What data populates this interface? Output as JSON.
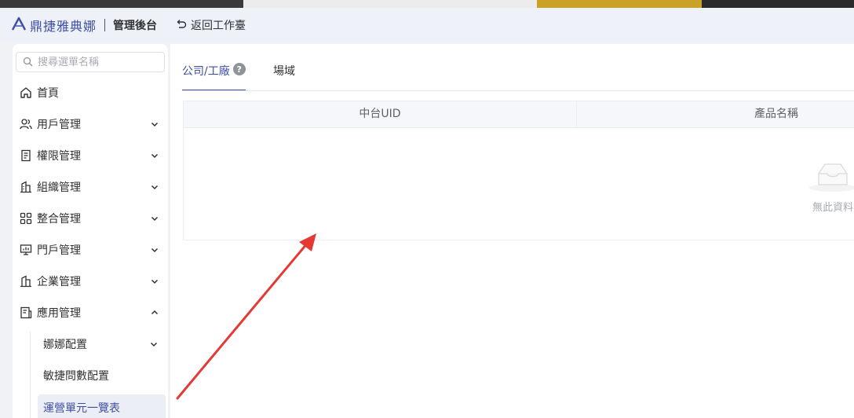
{
  "header": {
    "logo_text": "鼎捷雅典娜",
    "admin_title": "管理後台",
    "back_label": "返回工作臺"
  },
  "sidebar": {
    "search_placeholder": "搜尋選單名稱",
    "items": [
      {
        "label": "首頁",
        "icon": "home-icon"
      },
      {
        "label": "用戶管理",
        "icon": "users-icon",
        "expanded": false
      },
      {
        "label": "權限管理",
        "icon": "document-icon",
        "expanded": false
      },
      {
        "label": "組織管理",
        "icon": "organization-icon",
        "expanded": false
      },
      {
        "label": "整合管理",
        "icon": "grid-icon",
        "expanded": false
      },
      {
        "label": "門戶管理",
        "icon": "monitor-icon",
        "expanded": false
      },
      {
        "label": "企業管理",
        "icon": "building-icon",
        "expanded": false
      },
      {
        "label": "應用管理",
        "icon": "app-icon",
        "expanded": true
      }
    ],
    "sub_items": [
      {
        "label": "娜娜配置",
        "expandable": true
      },
      {
        "label": "敏捷問數配置"
      },
      {
        "label": "運營單元一覽表",
        "active": true
      }
    ]
  },
  "content": {
    "tabs": [
      {
        "label": "公司/工廠",
        "active": true
      },
      {
        "label": "場域"
      }
    ],
    "table": {
      "columns": [
        "中台UID",
        "產品名稱"
      ],
      "rows": [],
      "empty_text": "無此資料"
    }
  },
  "colors": {
    "accent": "#3f4fa3",
    "annotation_arrow": "#e53935"
  }
}
